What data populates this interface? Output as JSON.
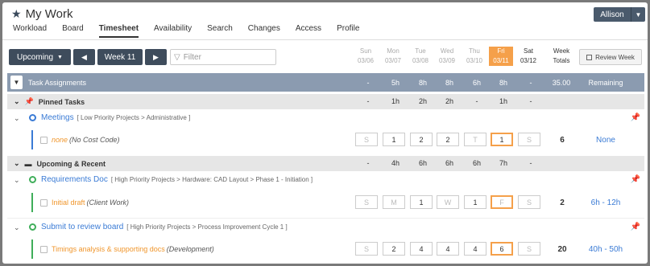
{
  "app": {
    "title": "My Work",
    "user": "Allison"
  },
  "nav": {
    "tabs": [
      "Workload",
      "Board",
      "Timesheet",
      "Availability",
      "Search",
      "Changes",
      "Access",
      "Profile"
    ],
    "active": "Timesheet"
  },
  "toolbar": {
    "view": "Upcoming",
    "week": "Week 11",
    "filter_placeholder": "Filter",
    "review": "Review Week"
  },
  "days": [
    {
      "name": "Sun",
      "date": "03/06"
    },
    {
      "name": "Mon",
      "date": "03/07"
    },
    {
      "name": "Tue",
      "date": "03/08"
    },
    {
      "name": "Wed",
      "date": "03/09"
    },
    {
      "name": "Thu",
      "date": "03/10"
    },
    {
      "name": "Fri",
      "date": "03/11"
    },
    {
      "name": "Sat",
      "date": "03/12"
    }
  ],
  "week_totals_label": "Week Totals",
  "assignments": {
    "label": "Task Assignments",
    "totals": [
      "-",
      "5h",
      "8h",
      "8h",
      "6h",
      "8h",
      "-"
    ],
    "week_total": "35.00",
    "remaining_label": "Remaining"
  },
  "pinned": {
    "label": "Pinned Tasks",
    "totals": [
      "-",
      "1h",
      "2h",
      "2h",
      "-",
      "1h",
      "-"
    ]
  },
  "meetings": {
    "name": "Meetings",
    "crumb": "[ Low Priority Projects > Administrative ]",
    "sub": {
      "name": "none",
      "code": "(No Cost Code)",
      "hours": [
        "S",
        "1",
        "2",
        "2",
        "T",
        "1",
        "S"
      ],
      "total": "6",
      "remaining": "None"
    }
  },
  "upcoming": {
    "label": "Upcoming & Recent",
    "totals": [
      "-",
      "4h",
      "6h",
      "6h",
      "6h",
      "7h",
      "-"
    ]
  },
  "req_doc": {
    "name": "Requirements Doc",
    "crumb": "[ High Priority Projects > Hardware: CAD Layout > Phase 1 - Initiation ]",
    "sub": {
      "name": "Initial draft",
      "code": "(Client Work)",
      "hours": [
        "S",
        "M",
        "1",
        "W",
        "1",
        "F",
        "S"
      ],
      "total": "2",
      "remaining": "6h - 12h"
    }
  },
  "submit": {
    "name": "Submit to review board",
    "crumb": "[ High Priority Projects > Process Improvement Cycle 1 ]",
    "sub": {
      "name": "Timings analysis & supporting docs",
      "code": "(Development)",
      "hours": [
        "S",
        "2",
        "4",
        "4",
        "4",
        "6",
        "S"
      ],
      "total": "20",
      "remaining": "40h - 50h"
    }
  }
}
